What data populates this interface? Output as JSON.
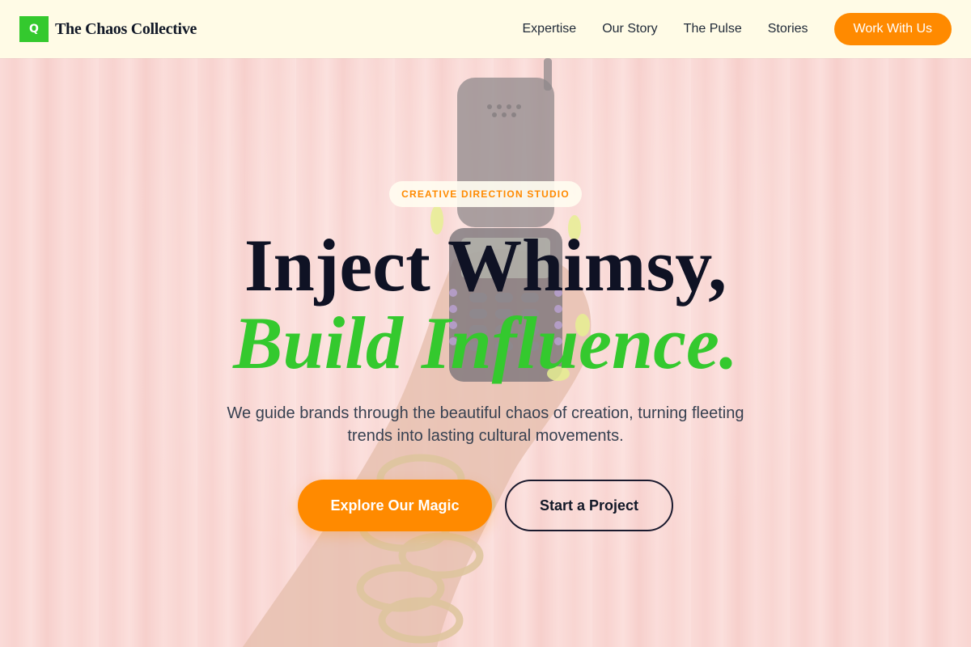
{
  "brand": {
    "mark": "Q",
    "name": "The Chaos Collective"
  },
  "nav": {
    "links": [
      "Expertise",
      "Our Story",
      "The Pulse",
      "Stories"
    ],
    "cta": "Work With Us"
  },
  "hero": {
    "eyebrow": "CREATIVE DIRECTION STUDIO",
    "headline_line1": "Inject Whimsy,",
    "headline_line2": "Build Influence.",
    "subtext": "We guide brands through the beautiful chaos of creation, turning fleeting trends into lasting cultural movements.",
    "primary_button": "Explore Our Magic",
    "secondary_button": "Start a Project"
  },
  "colors": {
    "accent_orange": "#ff8a00",
    "brand_green": "#34c92e",
    "nav_background": "#fffbe6",
    "headline_dark": "#0f1224",
    "curtain_pink": "#f6c9c4"
  },
  "icons": {
    "background_image": "hand-holding-flip-phone-image"
  }
}
